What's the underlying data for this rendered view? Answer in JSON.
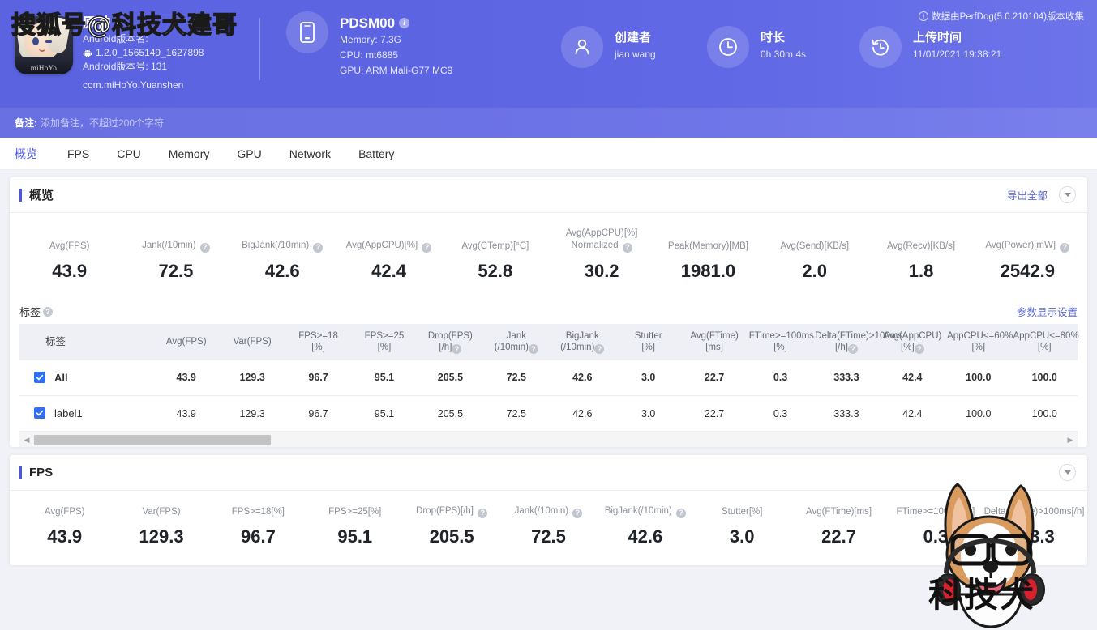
{
  "watermarks": {
    "top_text": "搜狐号@科技犬建哥",
    "dog_text": "科技犬"
  },
  "header": {
    "app": {
      "name": "原神",
      "android_version_name_label": "Android版本名:",
      "android_version_name": "1.2.0_1565149_1627898",
      "android_version_code": "Android版本号: 131",
      "package": "com.miHoYo.Yuanshen",
      "icon": "mihoyo-app-icon",
      "icon_caption": "miHoYo"
    },
    "device": {
      "icon": "phone-icon",
      "model": "PDSM00",
      "memory": "Memory: 7.3G",
      "cpu": "CPU: mt6885",
      "gpu": "GPU: ARM Mali-G77 MC9"
    },
    "creator": {
      "icon": "user-icon",
      "title": "创建者",
      "value": "jian wang"
    },
    "duration": {
      "icon": "clock-icon",
      "title": "时长",
      "value": "0h 30m 4s"
    },
    "upload": {
      "icon": "history-icon",
      "title": "上传时间",
      "value": "11/01/2021 19:38:21"
    },
    "perfdog_note": "数据由PerfDog(5.0.210104)版本收集",
    "remark_label": "备注:",
    "remark_placeholder": "添加备注，不超过200个字符",
    "accent": "#5b63e0"
  },
  "tabs": [
    {
      "label": "概览",
      "active": true
    },
    {
      "label": "FPS",
      "active": false
    },
    {
      "label": "CPU",
      "active": false
    },
    {
      "label": "Memory",
      "active": false
    },
    {
      "label": "GPU",
      "active": false
    },
    {
      "label": "Network",
      "active": false
    },
    {
      "label": "Battery",
      "active": false
    }
  ],
  "overview": {
    "title": "概览",
    "export_all": "导出全部",
    "metrics": [
      {
        "label": "Avg(FPS)",
        "help": false,
        "value": "43.9"
      },
      {
        "label": "Jank(/10min)",
        "help": true,
        "value": "72.5"
      },
      {
        "label": "BigJank(/10min)",
        "help": true,
        "value": "42.6"
      },
      {
        "label": "Avg(AppCPU)[%]",
        "help": true,
        "value": "42.4"
      },
      {
        "label": "Avg(CTemp)[°C]",
        "help": false,
        "value": "52.8"
      },
      {
        "label": "Avg(AppCPU)[%]",
        "label2": "Normalized",
        "help": true,
        "value": "30.2"
      },
      {
        "label": "Peak(Memory)[MB]",
        "help": false,
        "value": "1981.0"
      },
      {
        "label": "Avg(Send)[KB/s]",
        "help": false,
        "value": "2.0"
      },
      {
        "label": "Avg(Recv)[KB/s]",
        "help": false,
        "value": "1.8"
      },
      {
        "label": "Avg(Power)[mW]",
        "help": true,
        "value": "2542.9"
      }
    ],
    "table": {
      "section_label": "标签",
      "settings_link": "参数显示设置",
      "columns": [
        {
          "l1": "标签",
          "l2": "",
          "help": false,
          "is_label": true
        },
        {
          "l1": "Avg(FPS)",
          "l2": "",
          "help": false
        },
        {
          "l1": "Var(FPS)",
          "l2": "",
          "help": false
        },
        {
          "l1": "FPS>=18",
          "l2": "[%]",
          "help": false
        },
        {
          "l1": "FPS>=25",
          "l2": "[%]",
          "help": false
        },
        {
          "l1": "Drop(FPS)",
          "l2": "[/h]",
          "help": true
        },
        {
          "l1": "Jank",
          "l2": "(/10min)",
          "help": true
        },
        {
          "l1": "BigJank",
          "l2": "(/10min)",
          "help": true
        },
        {
          "l1": "Stutter",
          "l2": "[%]",
          "help": false
        },
        {
          "l1": "Avg(FTime)",
          "l2": "[ms]",
          "help": false
        },
        {
          "l1": "FTime>=100ms",
          "l2": "[%]",
          "help": false
        },
        {
          "l1": "Delta(FTime)>100ms",
          "l2": "[/h]",
          "help": true
        },
        {
          "l1": "Avg(AppCPU)",
          "l2": "[%]",
          "help": true
        },
        {
          "l1": "AppCPU<=60%",
          "l2": "[%]",
          "help": false
        },
        {
          "l1": "AppCPU<=80%",
          "l2": "[%]",
          "help": false
        }
      ],
      "rows": [
        {
          "label": "All",
          "checked": true,
          "bold": true,
          "values": [
            "43.9",
            "129.3",
            "96.7",
            "95.1",
            "205.5",
            "72.5",
            "42.6",
            "3.0",
            "22.7",
            "0.3",
            "333.3",
            "42.4",
            "100.0",
            "100.0"
          ]
        },
        {
          "label": "label1",
          "checked": true,
          "bold": false,
          "values": [
            "43.9",
            "129.3",
            "96.7",
            "95.1",
            "205.5",
            "72.5",
            "42.6",
            "3.0",
            "22.7",
            "0.3",
            "333.3",
            "42.4",
            "100.0",
            "100.0"
          ]
        }
      ],
      "scroll_left_arrow": "◀",
      "scroll_right_arrow": "▶"
    }
  },
  "fps": {
    "title": "FPS",
    "metrics": [
      {
        "label": "Avg(FPS)",
        "help": false,
        "value": "43.9"
      },
      {
        "label": "Var(FPS)",
        "help": false,
        "value": "129.3"
      },
      {
        "label": "FPS>=18[%]",
        "help": false,
        "value": "96.7"
      },
      {
        "label": "FPS>=25[%]",
        "help": false,
        "value": "95.1"
      },
      {
        "label": "Drop(FPS)[/h]",
        "help": true,
        "value": "205.5"
      },
      {
        "label": "Jank(/10min)",
        "help": true,
        "value": "72.5"
      },
      {
        "label": "BigJank(/10min)",
        "help": true,
        "value": "42.6"
      },
      {
        "label": "Stutter[%]",
        "help": false,
        "value": "3.0"
      },
      {
        "label": "Avg(FTime)[ms]",
        "help": false,
        "value": "22.7"
      },
      {
        "label": "FTime>=100ms[%]",
        "help": false,
        "value": "0.3"
      },
      {
        "label": "Delta(FTime)>100ms[/h]",
        "help": false,
        "value": "333.3"
      }
    ]
  }
}
